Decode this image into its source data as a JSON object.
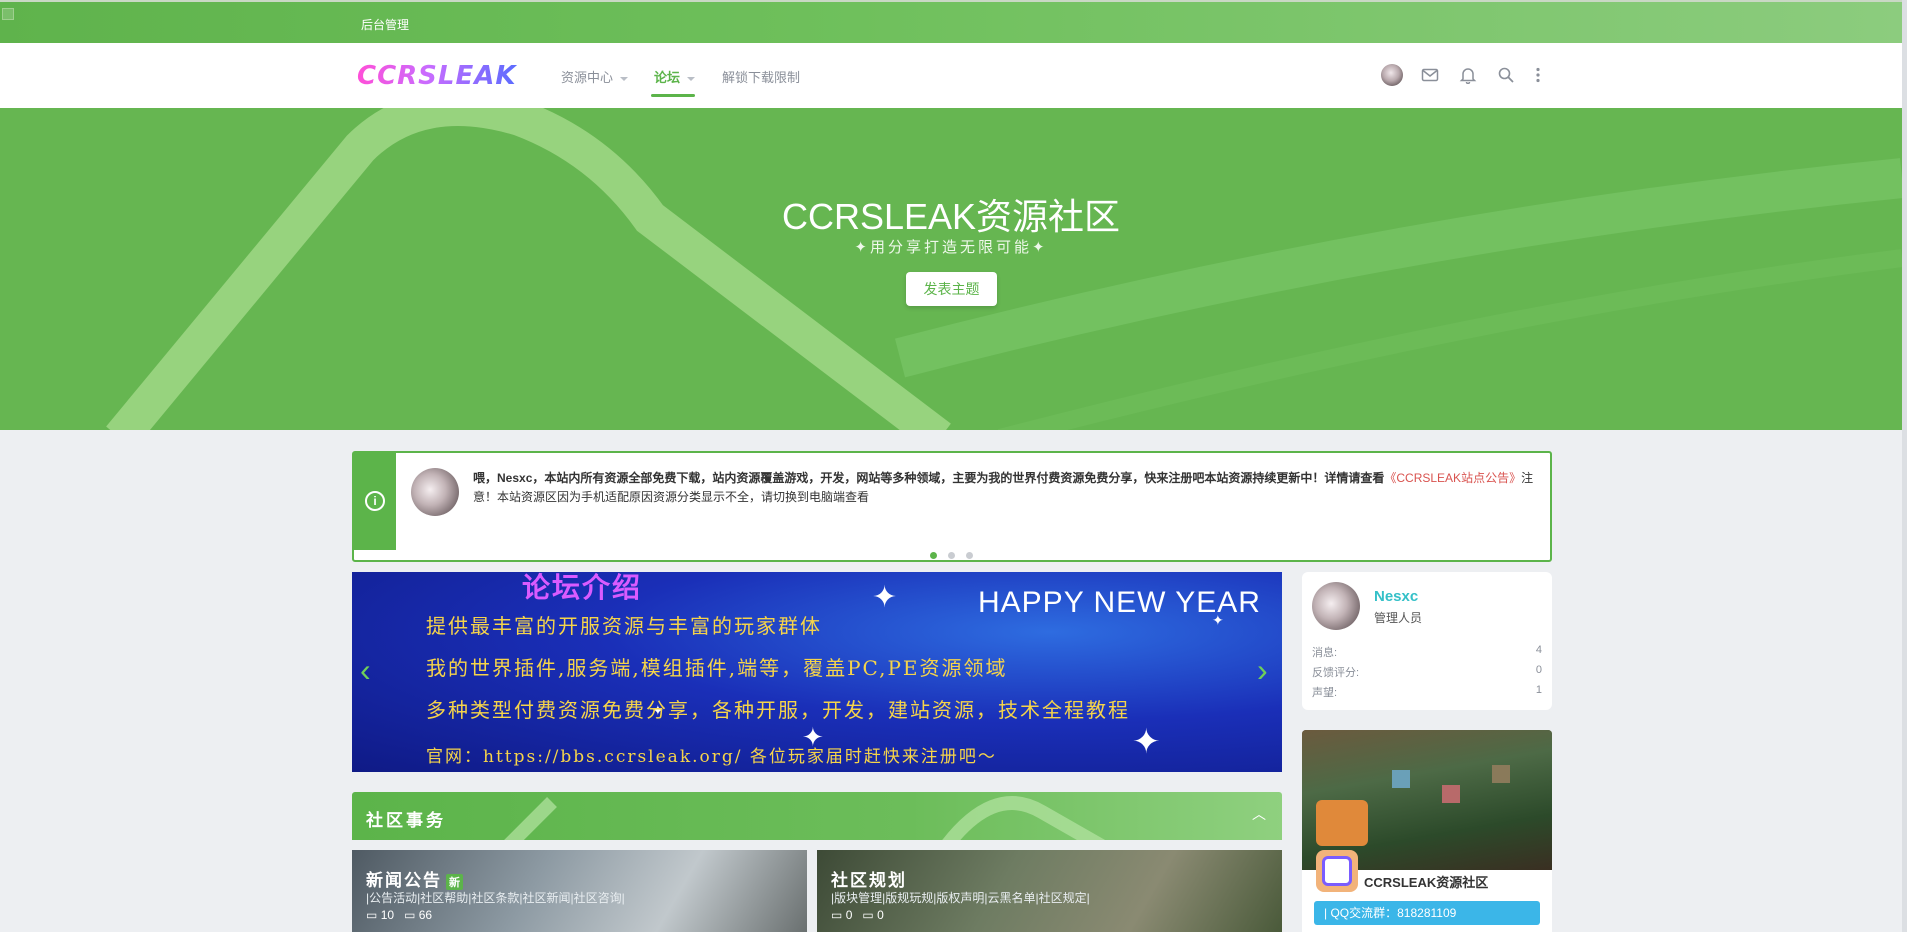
{
  "admin_bar": {
    "label": "后台管理"
  },
  "nav": {
    "logo": "CCRSLEAK",
    "items": [
      {
        "label": "资源中心"
      },
      {
        "label": "论坛"
      },
      {
        "label": "解锁下载限制"
      }
    ]
  },
  "hero": {
    "title": "CCRSLEAK资源社区",
    "subtitle": "✦用分享打造无限可能✦",
    "button": "发表主题"
  },
  "notice": {
    "greeting": "喂，Nesxc，本站内所有资源全部免费下载，站内资源覆盖游戏，开发，网站等多种领域，主要为我的世界付费资源免费分享，快来注册吧本站资源持续更新中！详情请查看",
    "link": "《CCRSLEAK站点公告》",
    "note": "注意！本站资源区因为手机适配原因资源分类显示不全，请切换到电脑端查看"
  },
  "banner": {
    "heading": "论坛介绍",
    "hny": "HAPPY NEW YEAR",
    "lines": [
      "提供最丰富的开服资源与丰富的玩家群体",
      "我的世界插件,服务端,模组插件,端等，覆盖PC,PE资源领域",
      "多种类型付费资源免费分享，各种开服，开发，建站资源，技术全程教程",
      "官网：https://bbs.ccrsleak.org/  各位玩家届时赶快来注册吧～"
    ]
  },
  "section": {
    "title": "社区事务"
  },
  "forums": [
    {
      "name": "新闻公告",
      "badge": "新",
      "subs": "|公告活动|社区帮助|社区条款|社区新闻|社区咨询|",
      "threads": "10",
      "posts": "66"
    },
    {
      "name": "社区规划",
      "badge": "",
      "subs": "|版块管理|版规玩规|版权声明|云黑名单|社区规定|",
      "threads": "0",
      "posts": "0"
    }
  ],
  "user": {
    "name": "Nesxc",
    "role": "管理人员",
    "stats": [
      {
        "label": "消息:",
        "value": "4"
      },
      {
        "label": "反馈评分:",
        "value": "0"
      },
      {
        "label": "声望:",
        "value": "1"
      }
    ]
  },
  "community": {
    "name": "CCRSLEAK资源社区",
    "qq": "| QQ交流群：818281109"
  },
  "colors": {
    "accent": "#5cb44a",
    "username": "#34c0c8",
    "notice_link": "#d9534f",
    "qq_button": "#3bb6e8"
  },
  "icons": [
    "info-icon",
    "mail-icon",
    "bell-icon",
    "search-icon",
    "more-vertical-icon",
    "chevron-up-icon",
    "chevron-left-icon",
    "chevron-right-icon",
    "comment-icon"
  ]
}
